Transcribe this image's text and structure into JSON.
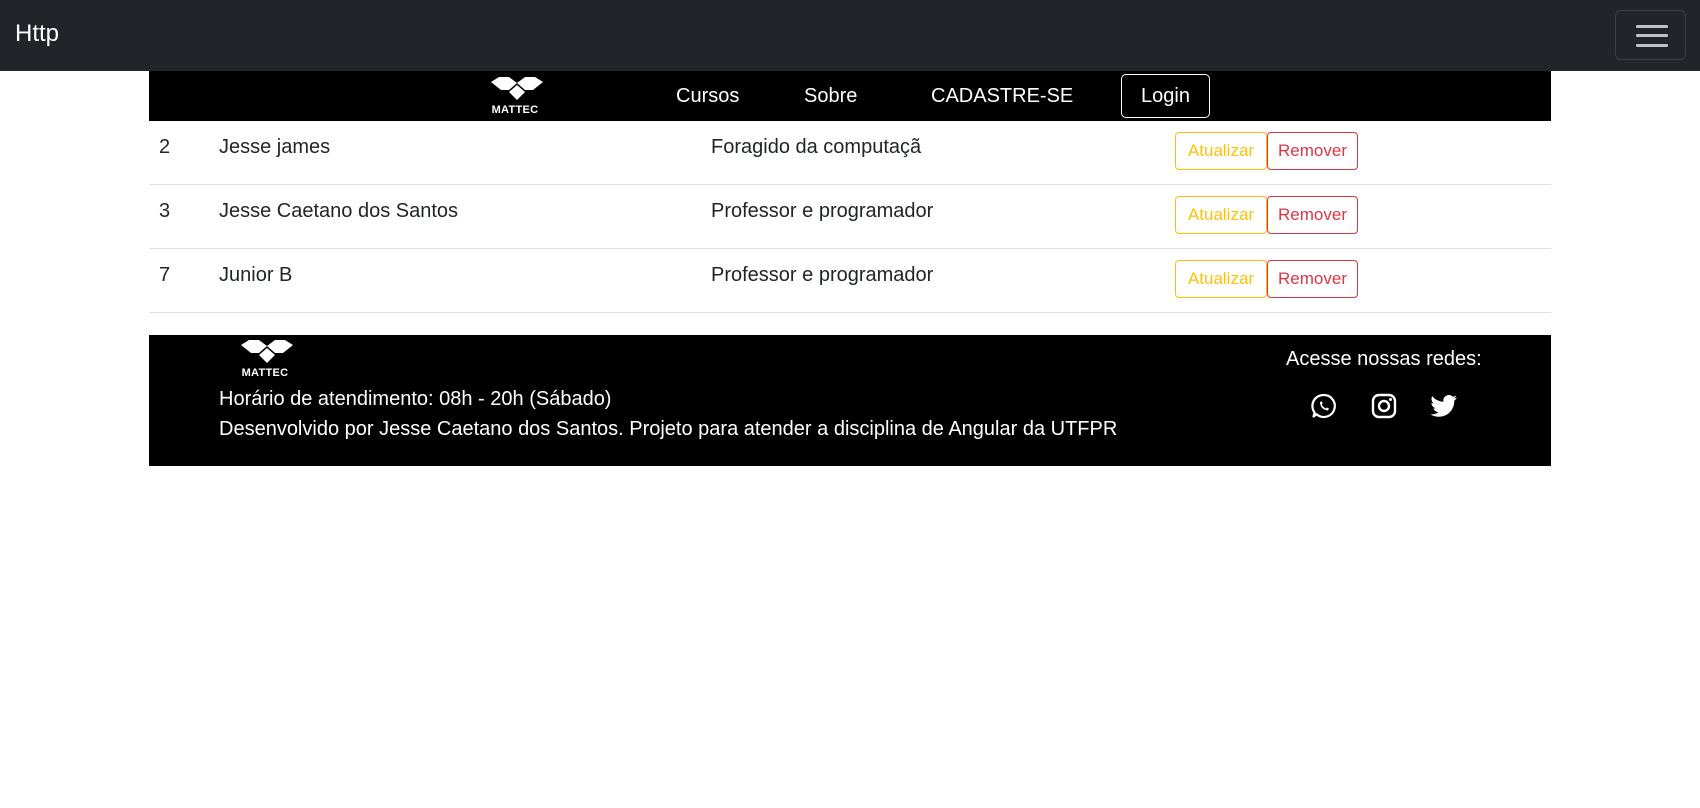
{
  "navbar": {
    "brand": "Http",
    "toggler_icon": "hamburger-icon"
  },
  "subnav": {
    "logo_text": "MATTEC",
    "links": [
      "Cursos",
      "Sobre",
      "CADASTRE-SE"
    ],
    "login_label": "Login"
  },
  "table": {
    "rows": [
      {
        "id": "2",
        "name": "Jesse james",
        "description": "Foragido da computaçã",
        "update_label": "Atualizar",
        "remove_label": "Remover"
      },
      {
        "id": "3",
        "name": "Jesse Caetano dos Santos",
        "description": "Professor e programador",
        "update_label": "Atualizar",
        "remove_label": "Remover"
      },
      {
        "id": "7",
        "name": "Junior B",
        "description": "Professor e programador",
        "update_label": "Atualizar",
        "remove_label": "Remover"
      }
    ]
  },
  "footer": {
    "logo_text": "MATTEC",
    "hours": "Horário de atendimento: 08h - 20h (Sábado)",
    "credits": "Desenvolvido por Jesse Caetano dos Santos. Projeto para atender a disciplina de Angular da UTFPR",
    "social_title": "Acesse nossas redes:",
    "social_icons": [
      "whatsapp-icon",
      "instagram-icon",
      "twitter-icon"
    ]
  },
  "colors": {
    "navbar_bg": "#212529",
    "subnav_bg": "#000000",
    "warning": "#ffc107",
    "danger": "#dc3545"
  }
}
